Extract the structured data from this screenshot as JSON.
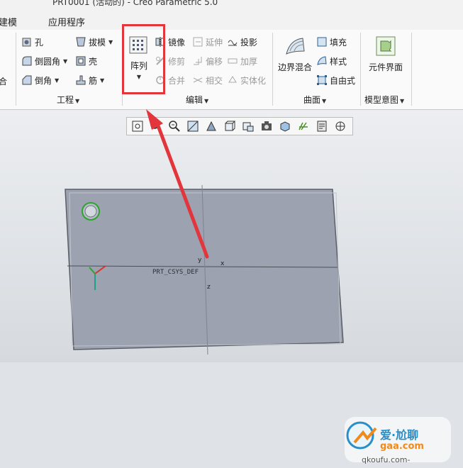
{
  "window": {
    "title": "PRT0001 (活动的) - Creo Parametric 5.0"
  },
  "tabs": [
    {
      "label": "建模"
    },
    {
      "label": "应用程序"
    }
  ],
  "ribbon": {
    "left_cut": {
      "label": "合"
    },
    "engineering": {
      "items": {
        "hole": "孔",
        "round": "倒圆角",
        "chamfer": "倒角",
        "draft": "拔模",
        "shell": "壳",
        "rib": "筋"
      },
      "group_label": "工程"
    },
    "editing": {
      "pattern": {
        "label": "阵列"
      },
      "items": {
        "mirror": "镜像",
        "extend": "延伸",
        "project": "投影",
        "trim": "修剪",
        "offset": "偏移",
        "thicken": "加厚",
        "merge": "合并",
        "intersect": "相交",
        "solidify": "实体化"
      },
      "group_label": "编辑"
    },
    "surfaces": {
      "boundary_blend": "边界混合",
      "items": {
        "fill": "填充",
        "style": "样式",
        "freestyle": "自由式"
      },
      "group_label": "曲面"
    },
    "model_intent": {
      "component_interface": "元件界面",
      "group_label": "模型意图"
    }
  },
  "view_toolbar": {
    "icons": [
      "refit-icon",
      "zoom-in-icon",
      "zoom-out-icon",
      "repaint-icon",
      "display-style-icon",
      "saved-orientations-icon",
      "named-views-icon",
      "view-manager-icon",
      "perspective-icon",
      "datum-display-icon",
      "annotation-display-icon",
      "spin-center-icon"
    ]
  },
  "model": {
    "csys_label": "PRT_CSYS_DEF",
    "axis_x": "x",
    "axis_z": "z",
    "axis_y": "y"
  },
  "watermark": {
    "line1": "爱·尬聊",
    "line2": "gaa.com",
    "url": "qkoufu.com-"
  },
  "colors": {
    "accent_red": "#e2363c",
    "plate": "#9ca2b0",
    "highlight_green": "#2ea32e"
  }
}
